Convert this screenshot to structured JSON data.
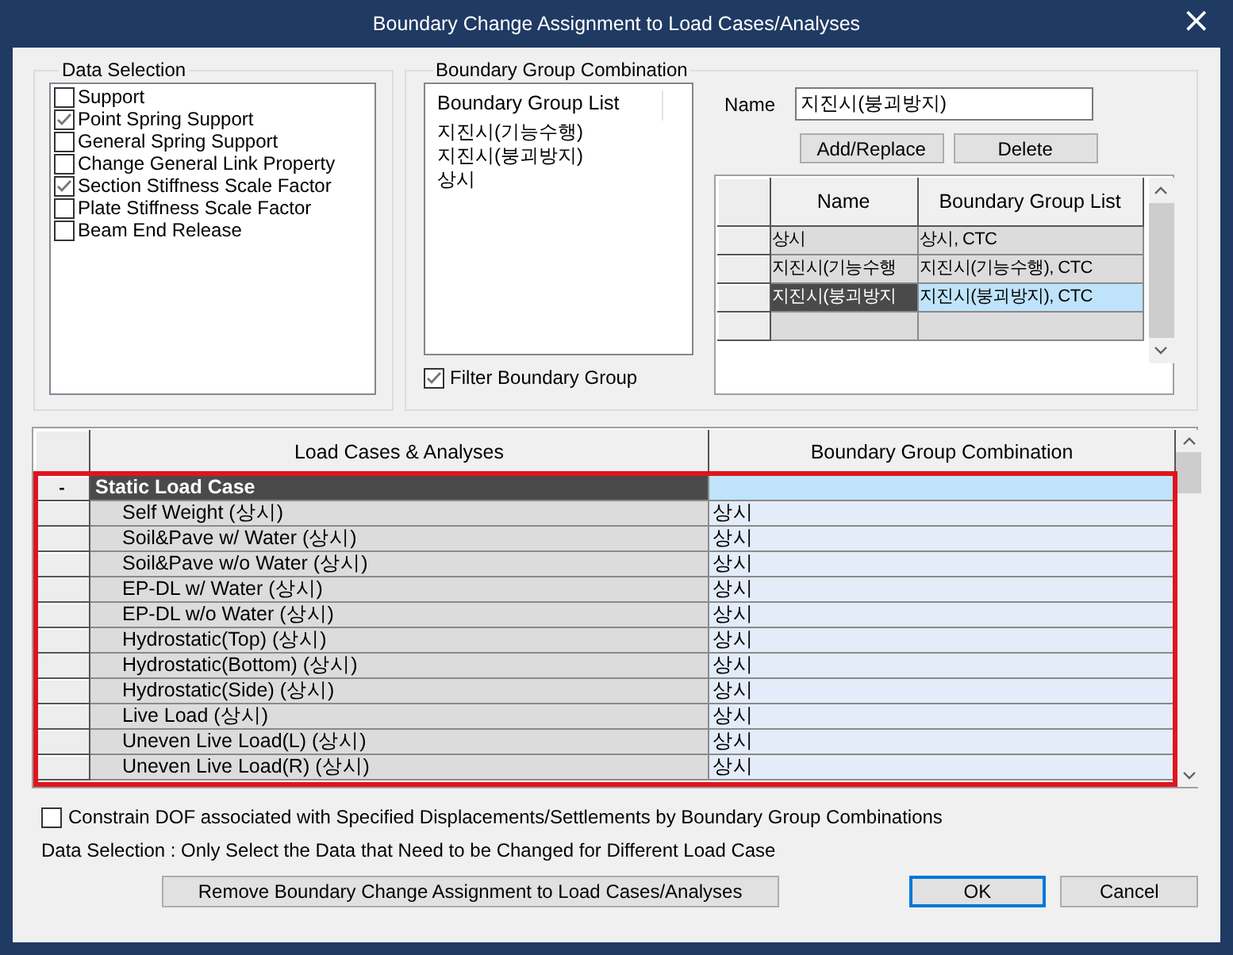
{
  "window": {
    "title": "Boundary Change Assignment to Load Cases/Analyses",
    "close": "×"
  },
  "data_selection": {
    "title": "Data Selection",
    "items": [
      {
        "label": "Support",
        "checked": false
      },
      {
        "label": "Point Spring Support",
        "checked": true
      },
      {
        "label": "General Spring Support",
        "checked": false
      },
      {
        "label": "Change General Link Property",
        "checked": false
      },
      {
        "label": "Section Stiffness Scale Factor",
        "checked": true
      },
      {
        "label": "Plate Stiffness Scale Factor",
        "checked": false
      },
      {
        "label": "Beam End Release",
        "checked": false
      }
    ]
  },
  "boundary_group_combination": {
    "title": "Boundary Group Combination",
    "group_list": {
      "header": "Boundary Group List",
      "items": [
        "지진시(기능수행)",
        "지진시(붕괴방지)",
        "상시"
      ]
    },
    "filter": {
      "label": "Filter Boundary Group",
      "checked": true
    },
    "name": {
      "label": "Name",
      "value": "지진시(붕괴방지)"
    },
    "buttons": [
      "Add/Replace",
      "Delete"
    ],
    "table": {
      "columns": [
        "Name",
        "Boundary Group List"
      ],
      "rows": [
        {
          "name": "상시",
          "groups": "상시, CTC",
          "selected": false
        },
        {
          "name": "지진시(기능수행",
          "groups": "지진시(기능수행), CTC",
          "selected": false
        },
        {
          "name": "지진시(붕괴방지",
          "groups": "지진시(붕괴방지), CTC",
          "selected": true
        }
      ]
    }
  },
  "load_cases": {
    "columns": [
      "Load Cases & Analyses",
      "Boundary Group Combination"
    ],
    "highlighted": true,
    "groups": [
      {
        "label": "Static Load Case",
        "toggle": "-",
        "expanded": true,
        "selected": true,
        "rows": [
          {
            "name": "Self Weight (상시)",
            "combination": "상시"
          },
          {
            "name": "Soil&Pave w/ Water (상시)",
            "combination": "상시"
          },
          {
            "name": "Soil&Pave w/o Water (상시)",
            "combination": "상시"
          },
          {
            "name": "EP-DL w/ Water (상시)",
            "combination": "상시"
          },
          {
            "name": "EP-DL w/o Water (상시)",
            "combination": "상시"
          },
          {
            "name": "Hydrostatic(Top) (상시)",
            "combination": "상시"
          },
          {
            "name": "Hydrostatic(Bottom) (상시)",
            "combination": "상시"
          },
          {
            "name": "Hydrostatic(Side) (상시)",
            "combination": "상시"
          },
          {
            "name": "Live Load (상시)",
            "combination": "상시"
          },
          {
            "name": "Uneven Live Load(L) (상시)",
            "combination": "상시"
          },
          {
            "name": "Uneven Live Load(R) (상시)",
            "combination": "상시"
          }
        ]
      }
    ]
  },
  "constrain": {
    "label": "Constrain DOF associated with Specified Displacements/Settlements by Boundary Group Combinations",
    "checked": false
  },
  "note": "Data Selection : Only Select the Data that Need to be Changed for Different Load Case",
  "buttons": [
    {
      "label": "Remove Boundary Change Assignment to Load Cases/Analyses",
      "default": false
    },
    {
      "label": "OK",
      "default": true
    },
    {
      "label": "Cancel",
      "default": false
    }
  ]
}
